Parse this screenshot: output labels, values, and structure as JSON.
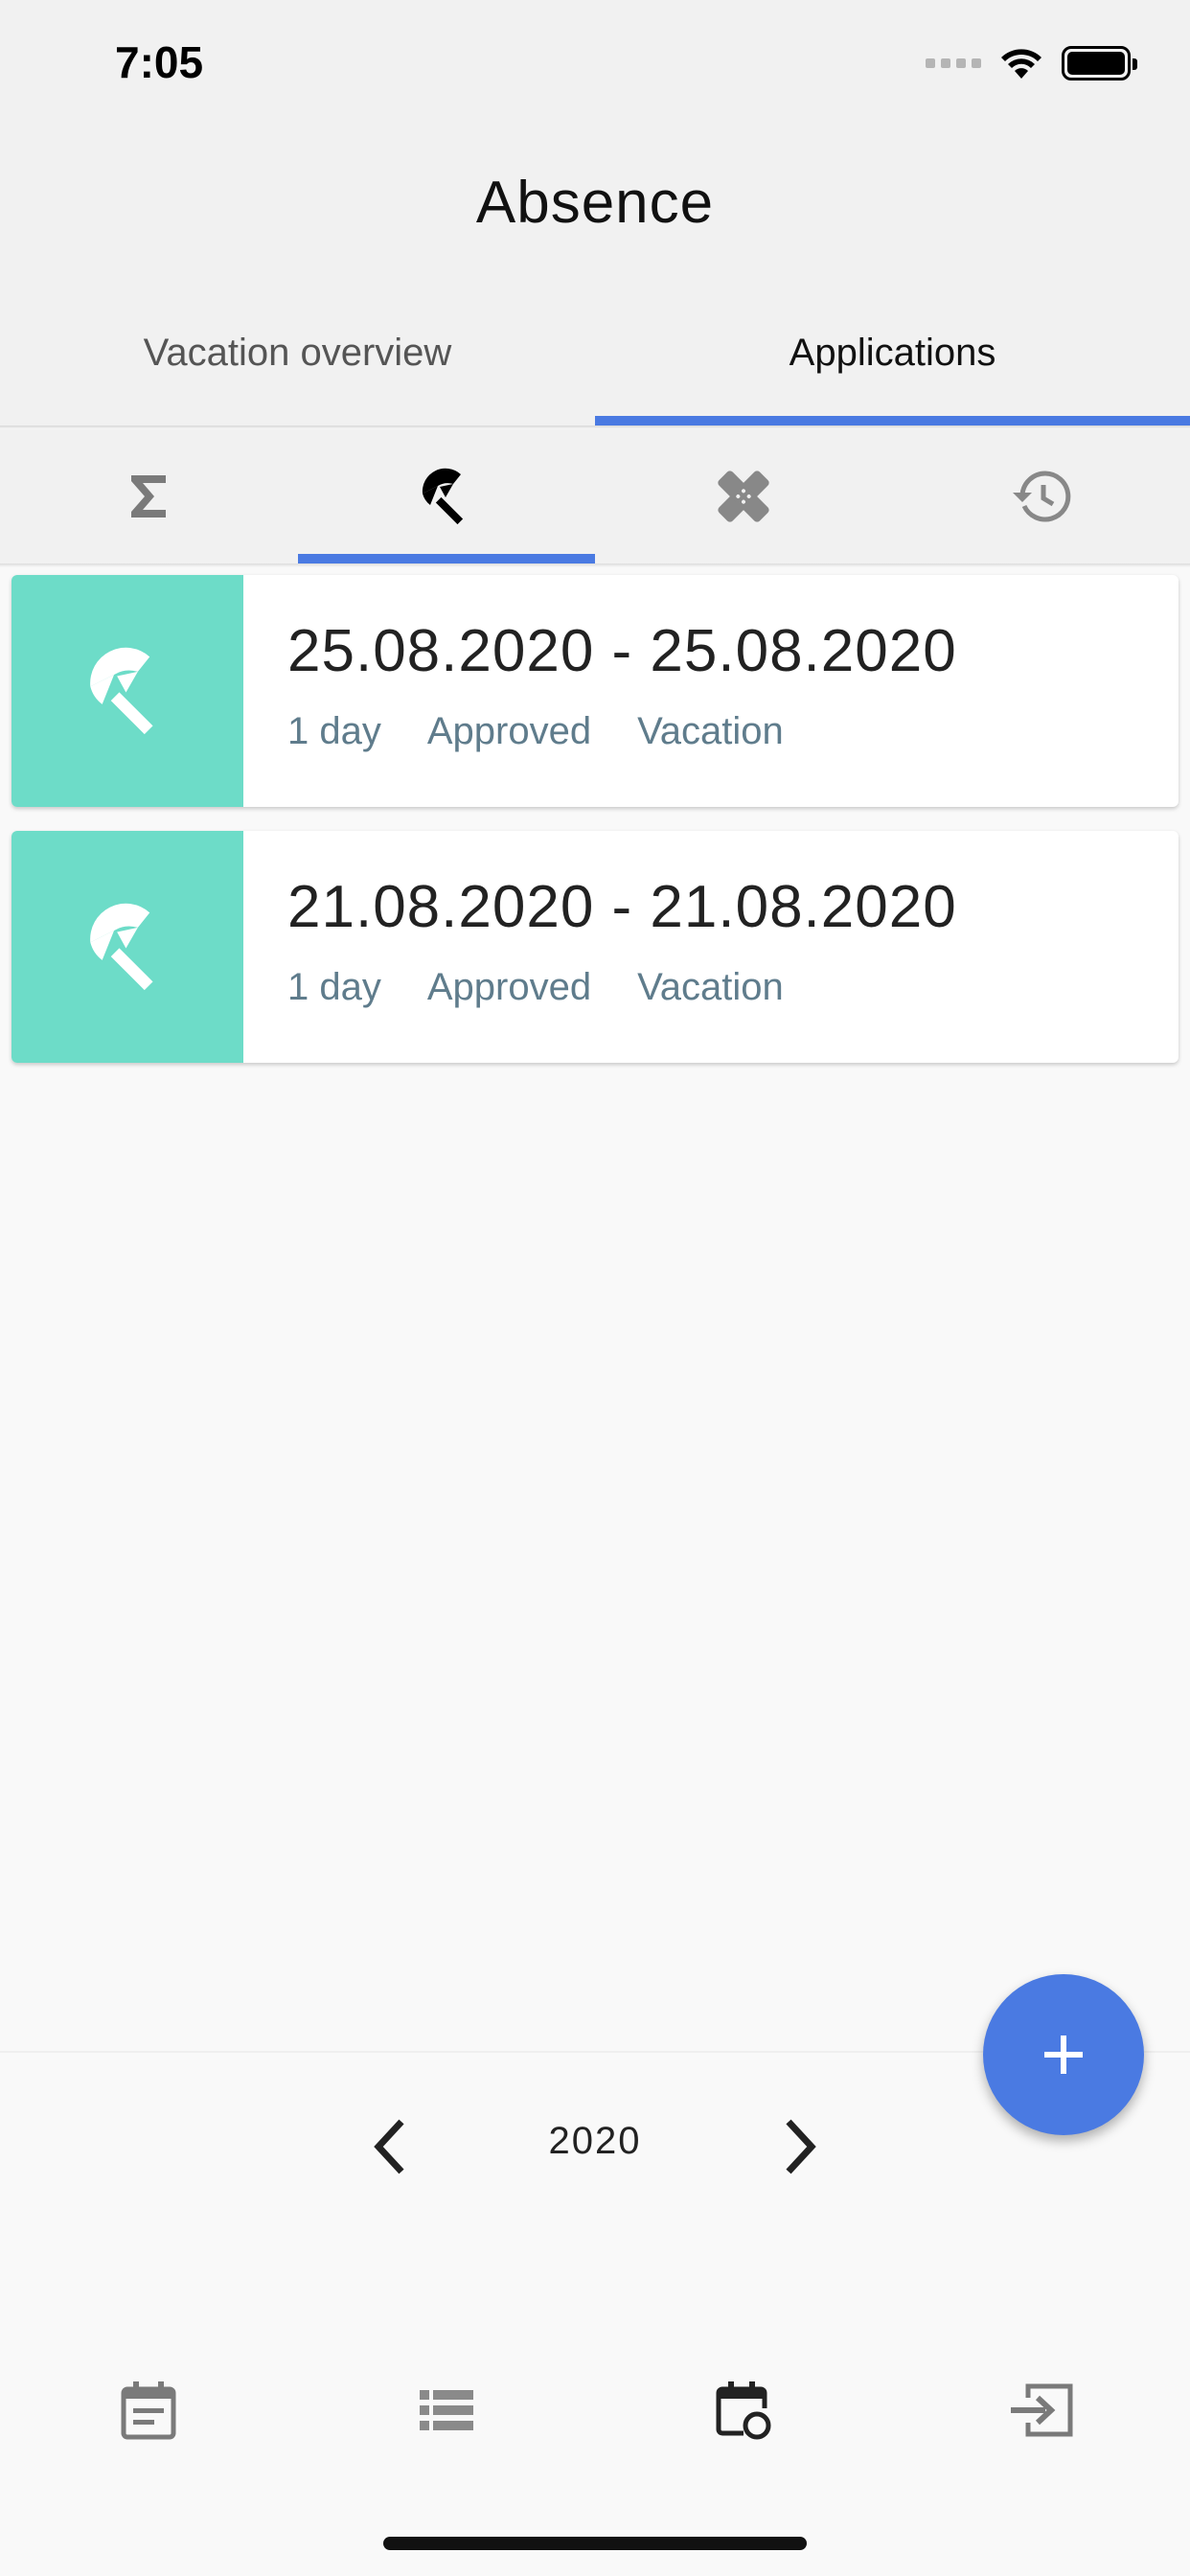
{
  "status_bar": {
    "time": "7:05"
  },
  "header": {
    "title": "Absence",
    "tabs": [
      {
        "label": "Vacation overview",
        "active": false
      },
      {
        "label": "Applications",
        "active": true
      }
    ]
  },
  "sub_tabs": [
    {
      "icon": "sigma-icon",
      "active": false
    },
    {
      "icon": "umbrella-icon",
      "active": true
    },
    {
      "icon": "bandage-icon",
      "active": false
    },
    {
      "icon": "history-icon",
      "active": false
    }
  ],
  "applications": [
    {
      "dates": "25.08.2020 - 25.08.2020",
      "duration": "1 day",
      "status": "Approved",
      "type": "Vacation",
      "icon": "umbrella-icon"
    },
    {
      "dates": "21.08.2020 - 21.08.2020",
      "duration": "1 day",
      "status": "Approved",
      "type": "Vacation",
      "icon": "umbrella-icon"
    }
  ],
  "year_nav": {
    "year": "2020"
  },
  "fab": {
    "icon": "plus-icon"
  },
  "bottom_nav": [
    {
      "icon": "calendar-note-icon"
    },
    {
      "icon": "list-icon"
    },
    {
      "icon": "calendar-clock-icon",
      "active": true
    },
    {
      "icon": "logout-icon"
    }
  ],
  "colors": {
    "accent": "#4a7ae2",
    "card_icon_bg": "#6ddcc8",
    "meta_text": "#5f7c8c"
  }
}
